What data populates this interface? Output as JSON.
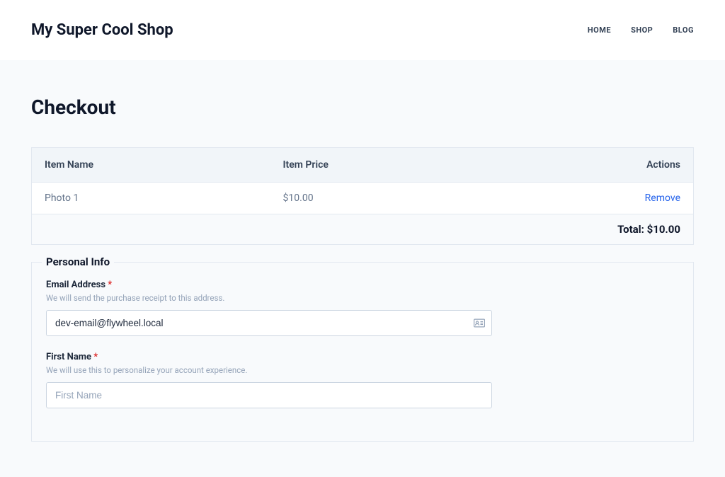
{
  "header": {
    "site_title": "My Super Cool Shop",
    "nav": [
      {
        "label": "HOME"
      },
      {
        "label": "SHOP"
      },
      {
        "label": "BLOG"
      }
    ]
  },
  "page": {
    "title": "Checkout"
  },
  "cart": {
    "columns": {
      "name": "Item Name",
      "price": "Item Price",
      "actions": "Actions"
    },
    "items": [
      {
        "name": "Photo 1",
        "price": "$10.00",
        "remove": "Remove"
      }
    ],
    "total_label": "Total: ",
    "total_value": "$10.00"
  },
  "form": {
    "legend": "Personal Info",
    "email": {
      "label": "Email Address ",
      "required": "*",
      "help": "We will send the purchase receipt to this address.",
      "value": "dev-email@flywheel.local"
    },
    "first_name": {
      "label": "First Name ",
      "required": "*",
      "help": "We will use this to personalize your account experience.",
      "placeholder": "First Name"
    }
  }
}
